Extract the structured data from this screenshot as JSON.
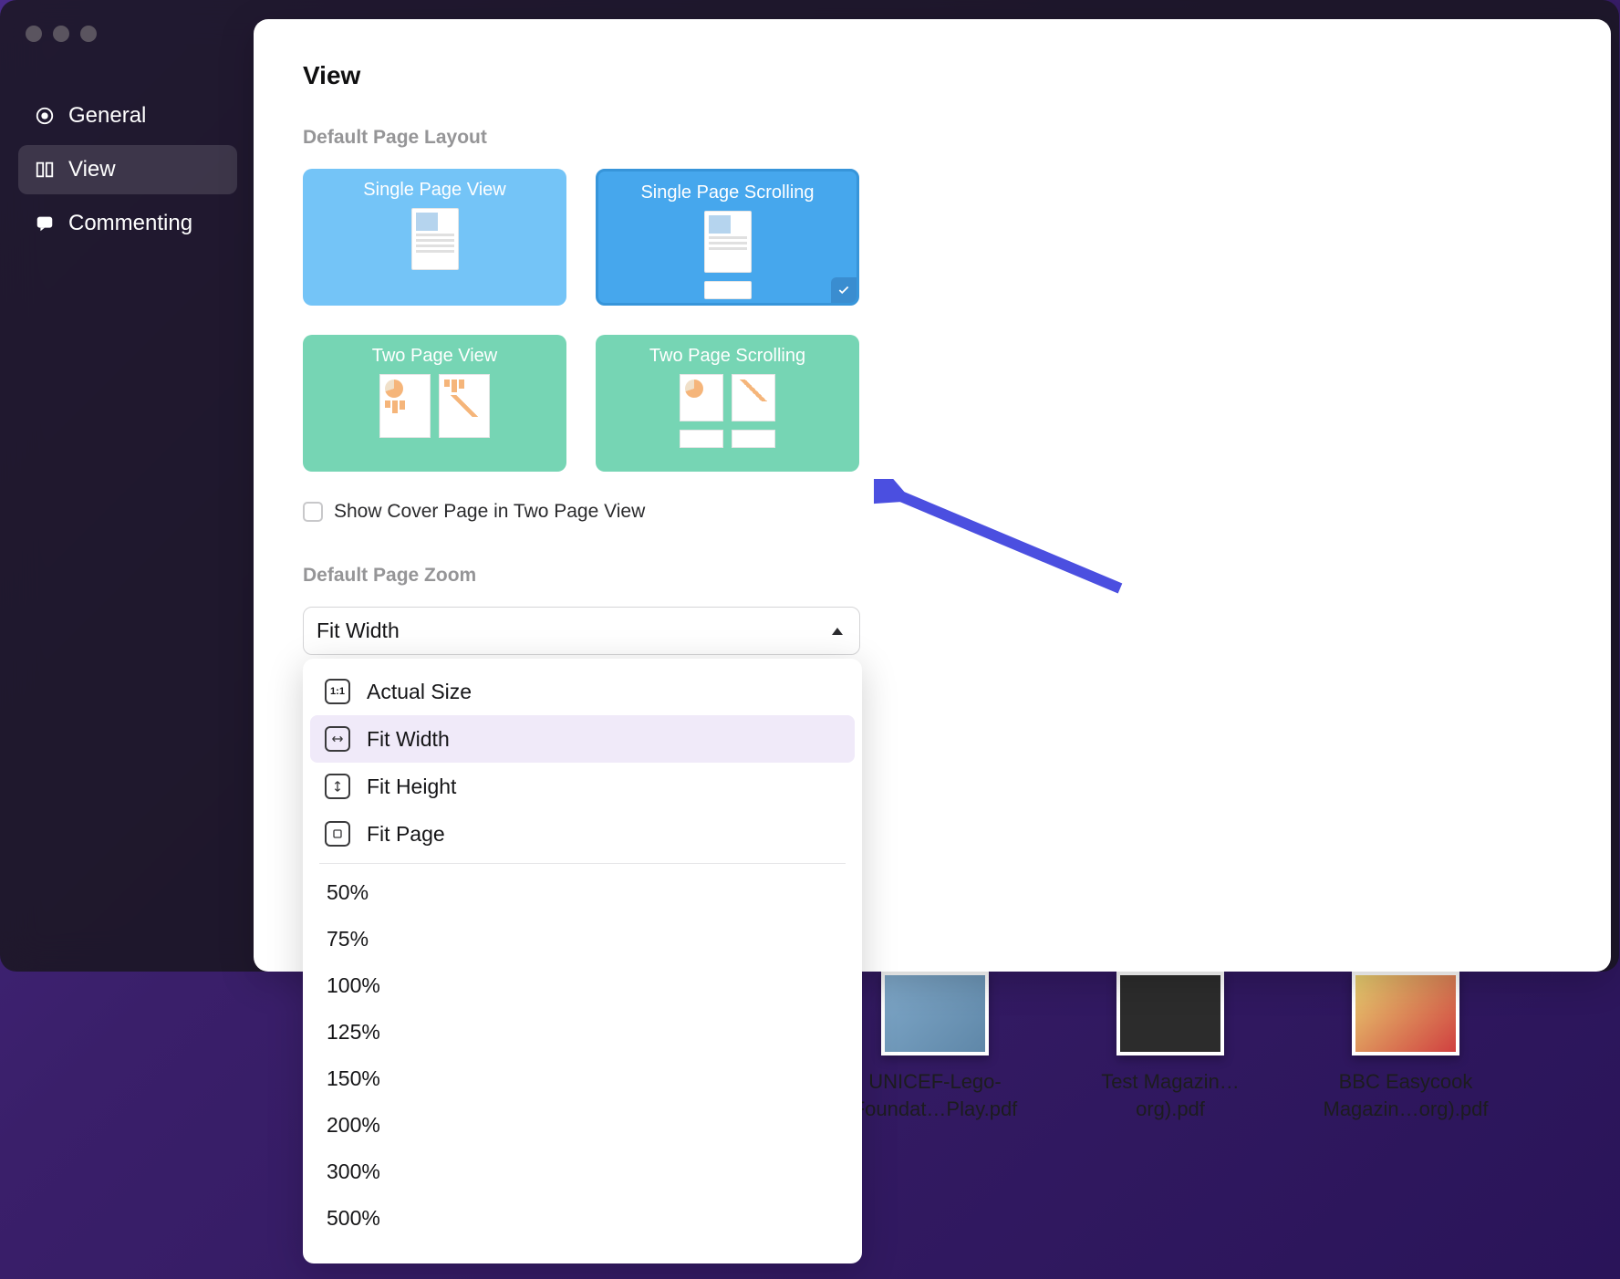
{
  "sidebar": {
    "items": [
      {
        "label": "General"
      },
      {
        "label": "View"
      },
      {
        "label": "Commenting"
      }
    ]
  },
  "panel": {
    "title": "View",
    "section_layout": "Default Page Layout",
    "section_zoom": "Default Page Zoom",
    "layouts": [
      {
        "label": "Single Page View"
      },
      {
        "label": "Single Page Scrolling"
      },
      {
        "label": "Two Page View"
      },
      {
        "label": "Two Page Scrolling"
      }
    ],
    "cover_checkbox": "Show Cover Page in Two Page View",
    "zoom_select": {
      "value": "Fit Width",
      "fit_options": [
        "Actual Size",
        "Fit Width",
        "Fit Height",
        "Fit Page"
      ],
      "percent_options": [
        "50%",
        "75%",
        "100%",
        "125%",
        "150%",
        "200%",
        "300%",
        "500%"
      ]
    }
  },
  "desktop_files": {
    "stub": "b",
    "items": [
      {
        "name": "UNICEF-Lego-Foundat…Play.pdf"
      },
      {
        "name": "Test Magazin…org).pdf"
      },
      {
        "name": "BBC Easycook Magazin…org).pdf"
      }
    ]
  }
}
